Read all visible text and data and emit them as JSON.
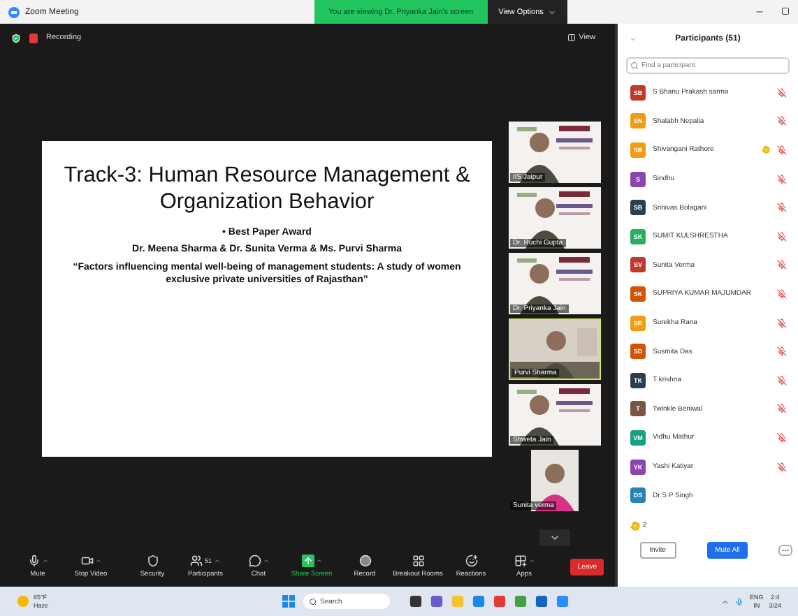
{
  "window": {
    "title": "Zoom Meeting"
  },
  "banner": {
    "text": "You are viewing Dr. Priyanka Jain's screen",
    "button": "View Options"
  },
  "status": {
    "recording": "Recording",
    "view": "View"
  },
  "slide": {
    "title": "Track-3: Human Resource Management & Organization Behavior",
    "bullet": "• Best Paper Award",
    "authors": "Dr. Meena Sharma & Dr. Sunita Verma & Ms. Purvi Sharma",
    "paper": "“Factors influencing mental well-being of management students: A study of women exclusive private universities of Rajasthan”"
  },
  "videos": [
    {
      "name": "IIS Jaipur",
      "speaking": false,
      "kind": "slide"
    },
    {
      "name": "Dr. Ruchi Gupta",
      "speaking": false,
      "kind": "slide"
    },
    {
      "name": "Dr. Priyanka Jain",
      "speaking": false,
      "kind": "slide"
    },
    {
      "name": "Purvi Sharma",
      "speaking": true,
      "kind": "room"
    },
    {
      "name": "Shweta Jain",
      "speaking": false,
      "kind": "slide"
    },
    {
      "name": "Sunita verma",
      "speaking": false,
      "kind": "portrait"
    }
  ],
  "participants": {
    "title": "Participants (51)",
    "search_placeholder": "Find a participant",
    "items": [
      {
        "initials": "SB",
        "name": "S Bhanu Prakash sarma",
        "color": "#c0392b",
        "hand_raised": false,
        "muted": true
      },
      {
        "initials": "SN",
        "name": "Shalabh Nepalia",
        "color": "#f39c12",
        "hand_raised": false,
        "muted": true
      },
      {
        "initials": "SR",
        "name": "Shivangani Rathore",
        "color": "#f39c12",
        "hand_raised": true,
        "muted": true
      },
      {
        "initials": "S",
        "name": "Sindhu",
        "color": "#8e44ad",
        "hand_raised": false,
        "muted": true
      },
      {
        "initials": "SB",
        "name": "Srinivas Bolagani",
        "color": "#2c3e50",
        "hand_raised": false,
        "muted": true
      },
      {
        "initials": "SK",
        "name": "SUMIT KULSHRESTHA",
        "color": "#27ae60",
        "hand_raised": false,
        "muted": true
      },
      {
        "initials": "SV",
        "name": "Sunita Verma",
        "color": "#c0392b",
        "hand_raised": false,
        "muted": true
      },
      {
        "initials": "SK",
        "name": "SUPRIYA KUMAR MAJUMDAR",
        "color": "#d35400",
        "hand_raised": false,
        "muted": true
      },
      {
        "initials": "SR",
        "name": "Surekha Rana",
        "color": "#f39c12",
        "hand_raised": false,
        "muted": true
      },
      {
        "initials": "SD",
        "name": "Susmita Das",
        "color": "#d35400",
        "hand_raised": false,
        "muted": true
      },
      {
        "initials": "TK",
        "name": "T krishna",
        "color": "#2c3e50",
        "hand_raised": false,
        "muted": true
      },
      {
        "initials": "T",
        "name": "Twinkle Beniwal",
        "color": "#795548",
        "hand_raised": false,
        "muted": true
      },
      {
        "initials": "VM",
        "name": "Vidhu Mathur",
        "color": "#16a085",
        "hand_raised": false,
        "muted": true
      },
      {
        "initials": "YK",
        "name": "Yashi Katiyar",
        "color": "#8e44ad",
        "hand_raised": false,
        "muted": true
      },
      {
        "initials": "DS",
        "name": "Dr S P Singh",
        "color": "#2980b9",
        "hand_raised": false,
        "muted": false
      }
    ],
    "raised_hands": "2",
    "invite": "Invite",
    "mute_all": "Mute All"
  },
  "toolbar": [
    {
      "kind": "mic",
      "label": "Mute"
    },
    {
      "kind": "video",
      "label": "Stop Video"
    },
    {
      "kind": "security",
      "label": "Security"
    },
    {
      "kind": "participants",
      "label": "Participants",
      "count": "51"
    },
    {
      "kind": "chat",
      "label": "Chat"
    },
    {
      "kind": "share",
      "label": "Share Screen"
    },
    {
      "kind": "record",
      "label": "Record"
    },
    {
      "kind": "breakout",
      "label": "Breakout Rooms"
    },
    {
      "kind": "reactions",
      "label": "Reactions"
    },
    {
      "kind": "apps",
      "label": "Apps"
    }
  ],
  "leave": "Leave",
  "taskbar": {
    "temperature": "85°F",
    "weather": "Haze",
    "search": "Search",
    "language": "ENG",
    "region": "IN",
    "time": "2:4",
    "date": "3/24"
  }
}
